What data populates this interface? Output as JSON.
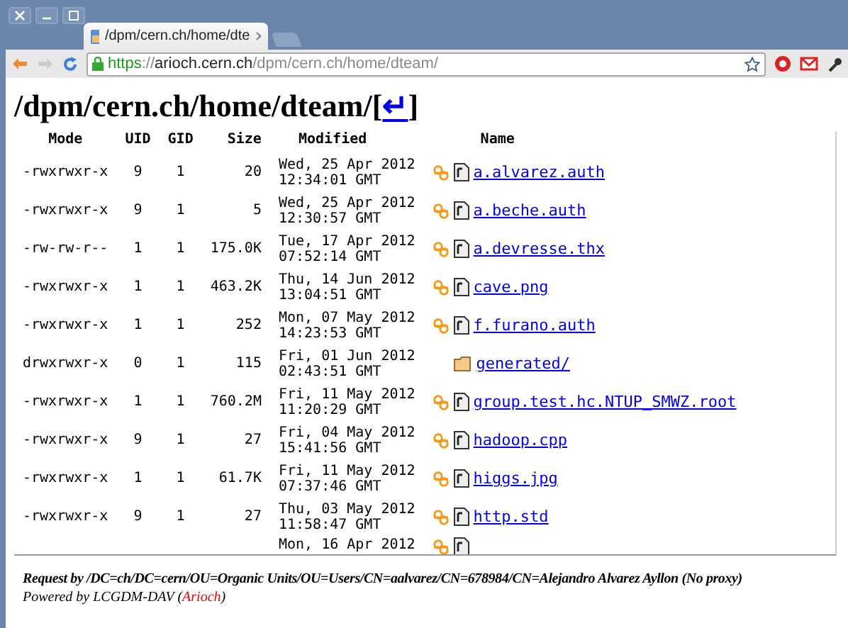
{
  "tab": {
    "title": "/dpm/cern.ch/home/dte"
  },
  "address": {
    "scheme": "https",
    "sep": "://",
    "host": "arioch.cern.ch",
    "path": "/dpm/cern.ch/home/dteam/"
  },
  "heading": {
    "path": "/dpm/cern.ch/home/dteam/",
    "open": "[",
    "link": "↵",
    "close": "]"
  },
  "table": {
    "columns": [
      "Mode",
      "UID",
      "GID",
      "Size",
      "Modified",
      "Name"
    ],
    "rows": [
      {
        "kind": "file",
        "mode": "-rwxrwxr-x",
        "uid": "9",
        "gid": "1",
        "size": "20",
        "date": "Wed, 25 Apr 2012",
        "time": "12:34:01 GMT",
        "name": "a.alvarez.auth"
      },
      {
        "kind": "file",
        "mode": "-rwxrwxr-x",
        "uid": "9",
        "gid": "1",
        "size": "5",
        "date": "Wed, 25 Apr 2012",
        "time": "12:30:57 GMT",
        "name": "a.beche.auth"
      },
      {
        "kind": "file",
        "mode": "-rw-rw-r--",
        "uid": "1",
        "gid": "1",
        "size": "175.0K",
        "date": "Tue, 17 Apr 2012",
        "time": "07:52:14 GMT",
        "name": "a.devresse.thx"
      },
      {
        "kind": "file",
        "mode": "-rwxrwxr-x",
        "uid": "1",
        "gid": "1",
        "size": "463.2K",
        "date": "Thu, 14 Jun 2012",
        "time": "13:04:51 GMT",
        "name": "cave.png"
      },
      {
        "kind": "file",
        "mode": "-rwxrwxr-x",
        "uid": "1",
        "gid": "1",
        "size": "252",
        "date": "Mon, 07 May 2012",
        "time": "14:23:53 GMT",
        "name": "f.furano.auth"
      },
      {
        "kind": "folder",
        "mode": "drwxrwxr-x",
        "uid": "0",
        "gid": "1",
        "size": "115",
        "date": "Fri, 01 Jun 2012",
        "time": "02:43:51 GMT",
        "name": "generated/"
      },
      {
        "kind": "file",
        "mode": "-rwxrwxr-x",
        "uid": "1",
        "gid": "1",
        "size": "760.2M",
        "date": "Fri, 11 May 2012",
        "time": "11:20:29 GMT",
        "name": "group.test.hc.NTUP_SMWZ.root"
      },
      {
        "kind": "file",
        "mode": "-rwxrwxr-x",
        "uid": "9",
        "gid": "1",
        "size": "27",
        "date": "Fri, 04 May 2012",
        "time": "15:41:56 GMT",
        "name": "hadoop.cpp"
      },
      {
        "kind": "file",
        "mode": "-rwxrwxr-x",
        "uid": "1",
        "gid": "1",
        "size": "61.7K",
        "date": "Fri, 11 May 2012",
        "time": "07:37:46 GMT",
        "name": "higgs.jpg"
      },
      {
        "kind": "file",
        "mode": "-rwxrwxr-x",
        "uid": "9",
        "gid": "1",
        "size": "27",
        "date": "Thu, 03 May 2012",
        "time": "11:58:47 GMT",
        "name": "http.std"
      },
      {
        "kind": "partial",
        "date": "Mon, 16 Apr 2012"
      }
    ]
  },
  "footer": {
    "request": "Request by /DC=ch/DC=cern/OU=Organic Units/OU=Users/CN=aalvarez/CN=678984/CN=Alejandro Alvarez Ayllon (No proxy)",
    "powered": "Powered by LCGDM-DAV (",
    "link": "Arioch",
    "close": ")"
  }
}
